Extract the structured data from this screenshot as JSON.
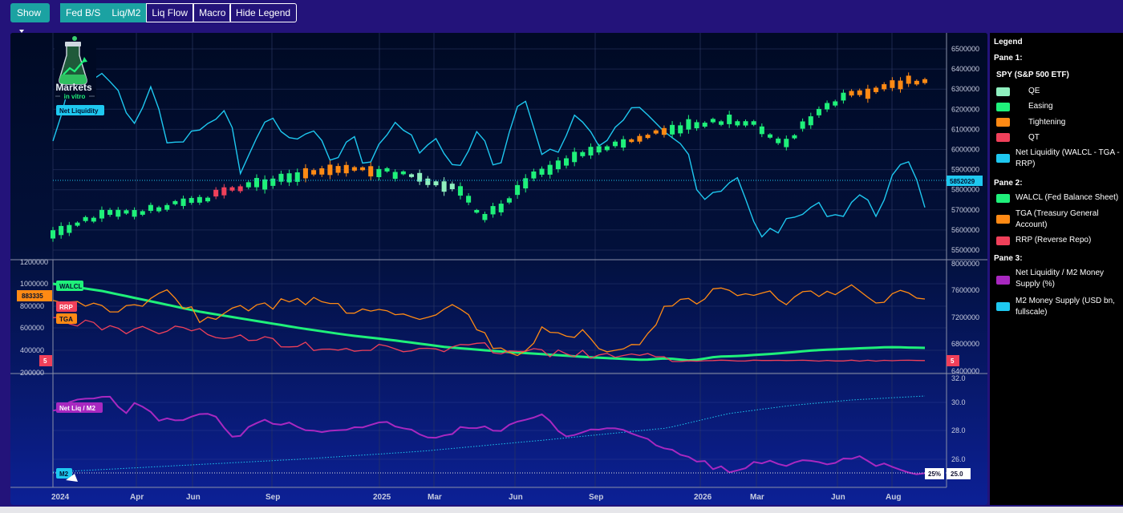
{
  "toolbar": {
    "show_label": "Show",
    "tabs": [
      "Fed B/S",
      "Liq/M2",
      "Liq Flow",
      "Macro"
    ],
    "active_tabs": [
      0,
      1
    ],
    "hide_legend_label": "Hide Legend"
  },
  "logo": {
    "line1": "Markets",
    "line2": "in vitro"
  },
  "pane1": {
    "y_ticks": [
      "6500000",
      "6400000",
      "6300000",
      "6200000",
      "6100000",
      "6000000",
      "5900000",
      "5800000",
      "5700000",
      "5600000",
      "5500000"
    ],
    "net_liq_tag": "Net Liquidity",
    "price_tag": "5852029"
  },
  "pane2": {
    "left_ticks": [
      "1200000",
      "1000000",
      "800000",
      "600000",
      "400000",
      "200000"
    ],
    "right_ticks": [
      "8000000",
      "7600000",
      "7200000",
      "6800000",
      "6400000"
    ],
    "walcl_tag": "WALCL",
    "rrp_tag": "RRP",
    "tga_tag": "TGA",
    "tga_value": "883335",
    "rrp_value": "5"
  },
  "pane3": {
    "right_ticks": [
      "32.0",
      "30.0",
      "28.0",
      "26.0"
    ],
    "ratio_tag": "Net Liq / M2",
    "m2_tag": "M2",
    "pct_value": "25%",
    "cur_value": "25.0"
  },
  "x_labels": [
    "2024",
    "Apr",
    "Jun",
    "Sep",
    "2025",
    "Mar",
    "Jun",
    "Sep",
    "2026",
    "Mar",
    "Jun",
    "Aug"
  ],
  "legend": {
    "heading": "Legend",
    "pane1_title": "Pane 1:",
    "spy_title": "SPY (S&P 500 ETF)",
    "pane1_items": [
      {
        "label": "QE",
        "color": "#8ff0bf"
      },
      {
        "label": "Easing",
        "color": "#1ff07a"
      },
      {
        "label": "Tightening",
        "color": "#ff8a14"
      },
      {
        "label": "QT",
        "color": "#f0405a"
      },
      {
        "label": "Net Liquidity (WALCL - TGA - RRP)",
        "color": "#1ec8f0"
      }
    ],
    "pane2_title": "Pane 2:",
    "pane2_items": [
      {
        "label": "WALCL (Fed Balance Sheet)",
        "color": "#1ff07a"
      },
      {
        "label": "TGA (Treasury General Account)",
        "color": "#ff8a14"
      },
      {
        "label": "RRP (Reverse Repo)",
        "color": "#f0405a"
      }
    ],
    "pane3_title": "Pane 3:",
    "pane3_items": [
      {
        "label": "Net Liquidity / M2 Money Supply (%)",
        "color": "#a828c0"
      },
      {
        "label": "M2 Money Supply (USD bn, fullscale)",
        "color": "#1ec8f0"
      }
    ]
  },
  "colors": {
    "accent": "#1ba2a2",
    "background": "#23137a",
    "net_liquidity": "#1ec8f0",
    "walcl": "#1ff07a",
    "tga": "#ff8a14",
    "rrp": "#f0405a",
    "ratio": "#a828c0",
    "m2": "#1ec8f0"
  }
}
